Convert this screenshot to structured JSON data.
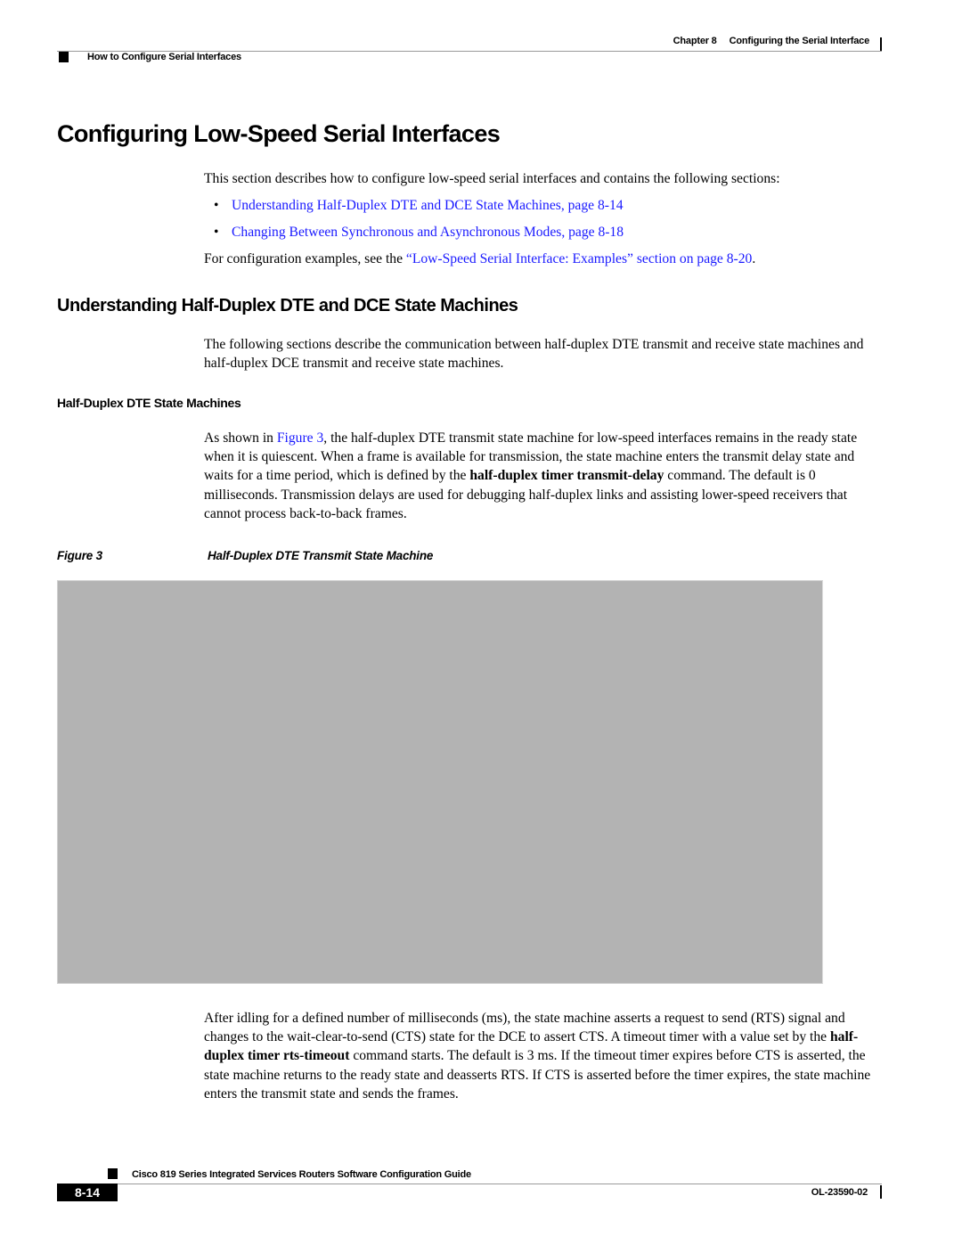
{
  "header": {
    "chapter_number": "Chapter 8",
    "chapter_title": "Configuring the Serial Interface",
    "section": "How to Configure Serial Interfaces"
  },
  "main": {
    "title": "Configuring Low-Speed Serial Interfaces",
    "intro": "This section describes how to configure low-speed serial interfaces and contains the following sections:",
    "bullets": [
      {
        "bullet": "•",
        "label": "Understanding Half-Duplex DTE and DCE State Machines, page 8-14"
      },
      {
        "bullet": "•",
        "label": "Changing Between Synchronous and Asynchronous Modes, page 8-18"
      }
    ],
    "config_examples": {
      "prefix": "For configuration examples, see the ",
      "link": "“Low-Speed Serial Interface: Examples” section on page 8-20",
      "suffix": "."
    },
    "section2": {
      "title": "Understanding Half-Duplex DTE and DCE State Machines",
      "paragraph": "The following sections describe the communication between half-duplex DTE transmit and receive state machines and half-duplex DCE transmit and receive state machines.",
      "subsection": {
        "title": "Half-Duplex DTE State Machines",
        "p1": {
          "t1": "As shown in ",
          "link": "Figure 3",
          "t2": ", the half-duplex DTE transmit state machine for low-speed interfaces remains in the ready state when it is quiescent. When a frame is available for transmission, the state machine enters the transmit delay state and waits for a time period, which is defined by the ",
          "cmd": "half-duplex timer transmit-delay",
          "t3": " command. The default is 0 milliseconds. Transmission delays are used for debugging half-duplex links and assisting lower-speed receivers that cannot process back-to-back frames."
        },
        "figure": {
          "label": "Figure 3",
          "caption": "Half-Duplex DTE Transmit State Machine"
        },
        "p2": {
          "t1": "After idling for a defined number of milliseconds (ms), the state machine asserts a request to send (RTS) signal and changes to the wait-clear-to-send (CTS) state for the DCE to assert CTS. A timeout timer with a value set by the ",
          "cmd": "half-duplex timer rts-timeout",
          "t2": " command starts. The default is 3 ms. If the timeout timer expires before CTS is asserted, the state machine returns to the ready state and deasserts RTS. If CTS is asserted before the timer expires, the state machine enters the transmit state and sends the frames."
        }
      }
    }
  },
  "footer": {
    "guide_title": "Cisco 819 Series Integrated Services Routers Software Configuration Guide",
    "page_number": "8-14",
    "doc_number": "OL-23590-02"
  },
  "colors": {
    "link": "#1a1aff",
    "figure_placeholder": "#b3b3b3",
    "rule": "#9a9a9a"
  }
}
